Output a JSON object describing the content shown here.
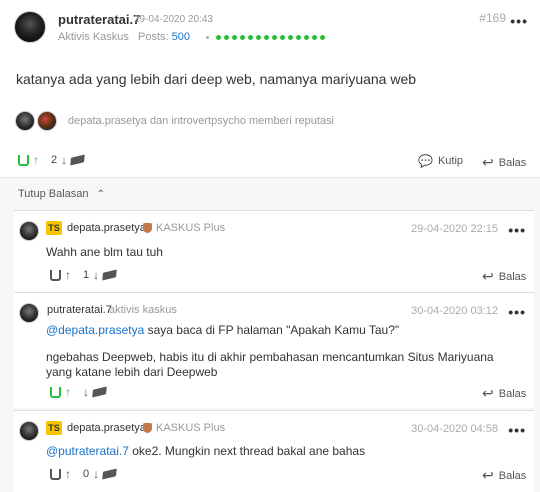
{
  "post": {
    "username": "putrateratai.7",
    "date": "29-04-2020 20:43",
    "post_number": "#169",
    "rank": "Aktivis Kaskus",
    "posts_label": "Posts:",
    "posts_count": "500",
    "content": "katanya ada yang lebih dari deep web, namanya mariyuana web",
    "reputation_givers": "depata.prasetya dan introvertpsycho memberi reputasi",
    "vote_count": "2",
    "quote_label": "Kutip",
    "reply_label": "Balas",
    "more": "•••"
  },
  "replies_toggle": {
    "label": "Tutup Balasan",
    "icon": "chevron-up-icon"
  },
  "replies": [
    {
      "badge": "TS",
      "username": "depata.prasetya",
      "level": "KASKUS Plus",
      "date": "29-04-2020 22:15",
      "text": "Wahh ane blm tau tuh",
      "vote_count": "1",
      "reply_label": "Balas"
    },
    {
      "username": "putrateratai.7",
      "level": "aktivis kaskus",
      "date": "30-04-2020 03:12",
      "mention": "@depata.prasetya",
      "text_after_mention": " saya baca di FP halaman \"Apakah Kamu Tau?\"",
      "text2": "ngebahas Deepweb, habis itu di akhir pembahasan mencantumkan Situs Mariyuana yang katane lebih dari Deepweb",
      "reply_label": "Balas"
    },
    {
      "badge": "TS",
      "username": "depata.prasetya",
      "level": "KASKUS Plus",
      "date": "30-04-2020 04:58",
      "mention": "@putrateratai.7",
      "text_after_mention": " oke2. Mungkin next thread bakal ane bahas",
      "vote_count": "0",
      "reply_label": "Balas"
    }
  ],
  "colors": {
    "accent_green": "#2dbb3a",
    "link_blue": "#1a73c8",
    "ts_badge": "#f6c700",
    "plus_shield": "#c07a4a"
  }
}
